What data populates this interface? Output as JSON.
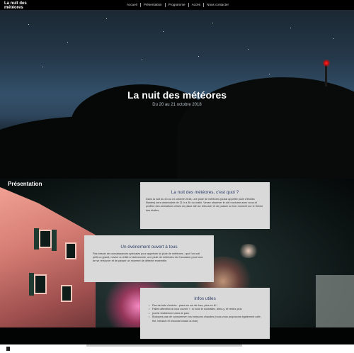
{
  "site": {
    "logo_line1": "La nuit des",
    "logo_line2": "météores"
  },
  "nav": [
    "Accueil",
    "Présentation",
    "Programme",
    "Accès",
    "Nous contacter"
  ],
  "hero": {
    "title": "La nuit des météores",
    "subtitle": "Du 20 au 21 octobre 2018"
  },
  "presentation": {
    "heading": "Présentation",
    "card1": {
      "title": "La nuit des météores, c'est quoi ?",
      "text": "Dans la nuit du 20 au 21 octobre 2018, une pluie de météores (aussi appelée pluie d'étoiles filantes) sera observable de 21 h à 3h du matin. Venez observer le ciel nocturne avec nous et profitez des animations mises en place afin se retrouver et de passer un bon moment sur le thème des étoiles."
    },
    "card2": {
      "title": "Un événement ouvert à tous",
      "text": "Pas besoin de connaissances spéciales pour apprécier la pluie de météores : que l'on soit petit ou grand, novice ou initié à l'astronomie, une pluie de météores est l'occasion pour tous de se retrouver et de passer un moment de détente ensemble."
    },
    "card3": {
      "title": "Infos utiles",
      "items": [
        "Pas de frais d'entrée : place en sol de fosz, plus en lit !",
        "Faites attention à vous couvrir ! : si vous le souhaitez, allez-y, et restez plus",
        "(sortis visiblement dans le parc.",
        "Boissons pas de consommer vos boissons chaudes (nous vous proposons également café, thé, infusion et chocolat chaud au bar)"
      ]
    }
  },
  "bottom": {
    "label": "P"
  },
  "colors": {
    "card_bg": "#d9d9d9",
    "card_title": "#2e3f6b",
    "beacon": "#e01b1b"
  }
}
